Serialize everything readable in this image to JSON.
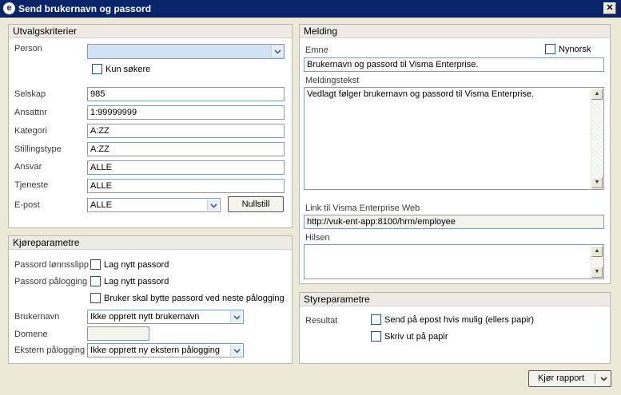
{
  "window": {
    "title": "Send brukernavn og passord",
    "app_icon_glyph": "e",
    "close_glyph": "✕"
  },
  "utvalg": {
    "header": "Utvalgskriterier",
    "person_label": "Person",
    "person_value": "",
    "kun_sokere_label": "Kun søkere",
    "selskap_label": "Selskap",
    "selskap_value": "985",
    "ansattnr_label": "Ansattnr",
    "ansattnr_value": "1:99999999",
    "kategori_label": "Kategori",
    "kategori_value": "A:ZZ",
    "stillingstype_label": "Stillingstype",
    "stillingstype_value": "A:ZZ",
    "ansvar_label": "Ansvar",
    "ansvar_value": "ALLE",
    "tjeneste_label": "Tjeneste",
    "tjeneste_value": "ALLE",
    "epost_label": "E-post",
    "epost_value": "ALLE",
    "nullstill_label": "Nullstill"
  },
  "kjore": {
    "header": "Kjøreparametre",
    "passord_lonnsslipp_label": "Passord lønnsslipp",
    "lag_nytt_passord_1": "Lag nytt passord",
    "passord_palogging_label": "Passord pålogging",
    "lag_nytt_passord_2": "Lag nytt passord",
    "bytte_passord_label": "Bruker skal bytte passord ved neste pålogging",
    "brukernavn_label": "Brukernavn",
    "brukernavn_value": "Ikke opprett nytt brukernavn",
    "domene_label": "Domene",
    "domene_value": "",
    "ekstern_label": "Ekstern pålogging",
    "ekstern_value": "Ikke opprett ny ekstern pålogging"
  },
  "melding": {
    "header": "Melding",
    "emne_label": "Emne",
    "nynorsk_label": "Nynorsk",
    "emne_value": "Brukernavn og passord til Visma Enterprise.",
    "meldingstekst_label": "Meldingstekst",
    "meldingstekst_value": "Vedlagt følger brukernavn og passord til Visma Enterprise.",
    "link_label": "Link til Visma Enterprise Web",
    "link_value": "http://vuk-ent-app:8100/hrm/employee",
    "hilsen_label": "Hilsen",
    "hilsen_value": ""
  },
  "styre": {
    "header": "Styreparametre",
    "resultat_label": "Resultat",
    "send_epost_label": "Send på epost hvis mulig (ellers papir)",
    "skriv_ut_label": "Skriv ut på papir"
  },
  "footer": {
    "kjor_rapport_label": "Kjør rapport"
  },
  "icons": {
    "app": "visma-e-icon",
    "close": "close-icon",
    "dropdown": "chevron-down-icon",
    "scroll_up": "scroll-up-icon",
    "scroll_down": "scroll-down-icon"
  }
}
